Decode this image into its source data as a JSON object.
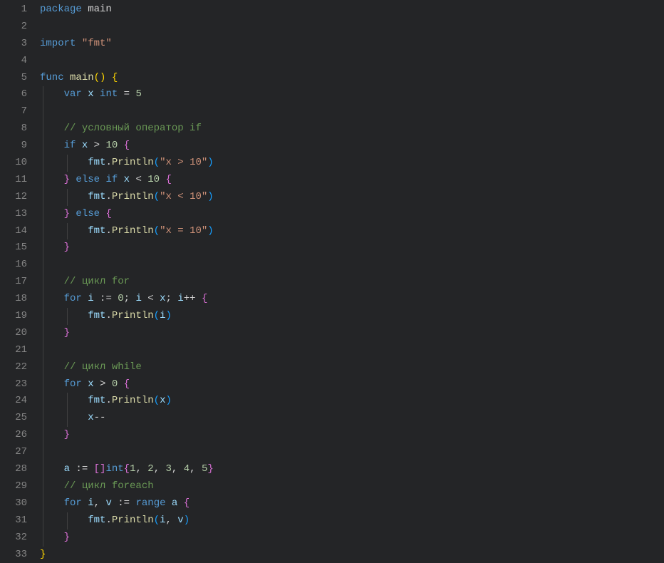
{
  "lineCount": 33,
  "tokens": {
    "l1": [
      [
        "kw",
        "package"
      ],
      [
        "",
        null
      ],
      " ",
      [
        "ident",
        "main"
      ]
    ],
    "l3": [
      [
        "kw",
        "import"
      ],
      [
        "",
        null
      ],
      " ",
      [
        "str",
        "\"fmt\""
      ]
    ],
    "l5": [
      [
        "kw",
        "func"
      ],
      [
        "",
        null
      ],
      " ",
      [
        "fn",
        "main"
      ],
      [
        "brace-y",
        "("
      ],
      [
        "brace-y",
        ")"
      ],
      [
        "",
        null
      ],
      " ",
      [
        "brace-y",
        "{"
      ]
    ],
    "l6_var": "var",
    "l6_x": "x",
    "l6_int": "int",
    "l6_eq": "=",
    "l6_5": "5",
    "l8_cmt": "// условный оператор if",
    "l9_if": "if",
    "l9_x": "x",
    "l9_gt": ">",
    "l9_10": "10",
    "l10_fmt": "fmt",
    "l10_dot": ".",
    "l10_println": "Println",
    "l10_str": "\"x > 10\"",
    "l11_else": "else",
    "l11_if": "if",
    "l11_x": "x",
    "l11_lt": "<",
    "l11_10": "10",
    "l12_str": "\"x < 10\"",
    "l13_else": "else",
    "l14_str": "\"x = 10\"",
    "l17_cmt": "// цикл for",
    "l18_for": "for",
    "l18_i": "i",
    "l18_ass": ":=",
    "l18_0": "0",
    "l18_semi": ";",
    "l18_lt": "<",
    "l18_x": "x",
    "l18_inc": "++",
    "l19_i": "i",
    "l22_cmt": "// цикл while",
    "l23_for": "for",
    "l23_x": "x",
    "l23_gt": ">",
    "l23_0": "0",
    "l24_x": "x",
    "l25_x": "x",
    "l25_dec": "--",
    "l28_a": "a",
    "l28_ass": ":=",
    "l28_int": "int",
    "l28_n1": "1",
    "l28_n2": "2",
    "l28_n3": "3",
    "l28_n4": "4",
    "l28_n5": "5",
    "l29_cmt": "// цикл foreach",
    "l30_for": "for",
    "l30_i": "i",
    "l30_v": "v",
    "l30_ass": ":=",
    "l30_range": "range",
    "l30_a": "a",
    "l31_i": "i",
    "l31_v": "v"
  }
}
